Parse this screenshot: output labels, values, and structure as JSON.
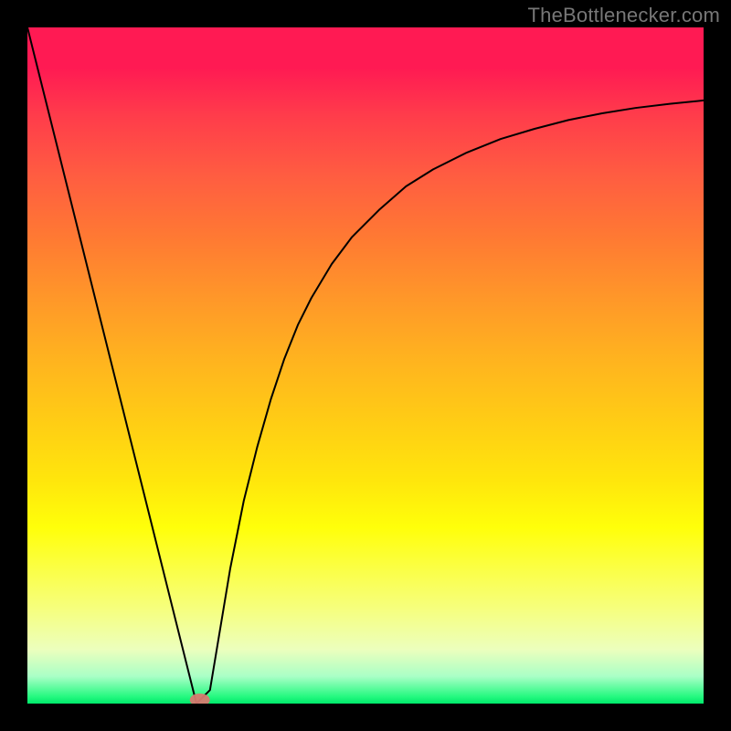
{
  "watermark": {
    "text": "TheBottlenecker.com"
  },
  "chart_data": {
    "type": "line",
    "title": "",
    "xlabel": "",
    "ylabel": "",
    "xlim": [
      0,
      100
    ],
    "ylim": [
      0,
      100
    ],
    "x": [
      0,
      2,
      4,
      6,
      8,
      10,
      12,
      14,
      16,
      18,
      20,
      22,
      24,
      25,
      27,
      28,
      29,
      30,
      32,
      34,
      36,
      38,
      40,
      42,
      45,
      48,
      52,
      56,
      60,
      65,
      70,
      75,
      80,
      85,
      90,
      95,
      100
    ],
    "values": [
      100,
      92,
      84,
      76,
      68,
      60,
      52,
      44,
      36,
      28,
      20,
      12,
      4,
      0,
      2,
      8,
      14,
      20,
      30,
      38,
      45,
      51,
      56,
      60,
      65,
      69,
      73,
      76.5,
      79,
      81.5,
      83.5,
      85,
      86.3,
      87.3,
      88.1,
      88.7,
      89.2
    ],
    "marker": {
      "x": 25.5,
      "y": 0
    },
    "legend": false,
    "grid": false
  }
}
